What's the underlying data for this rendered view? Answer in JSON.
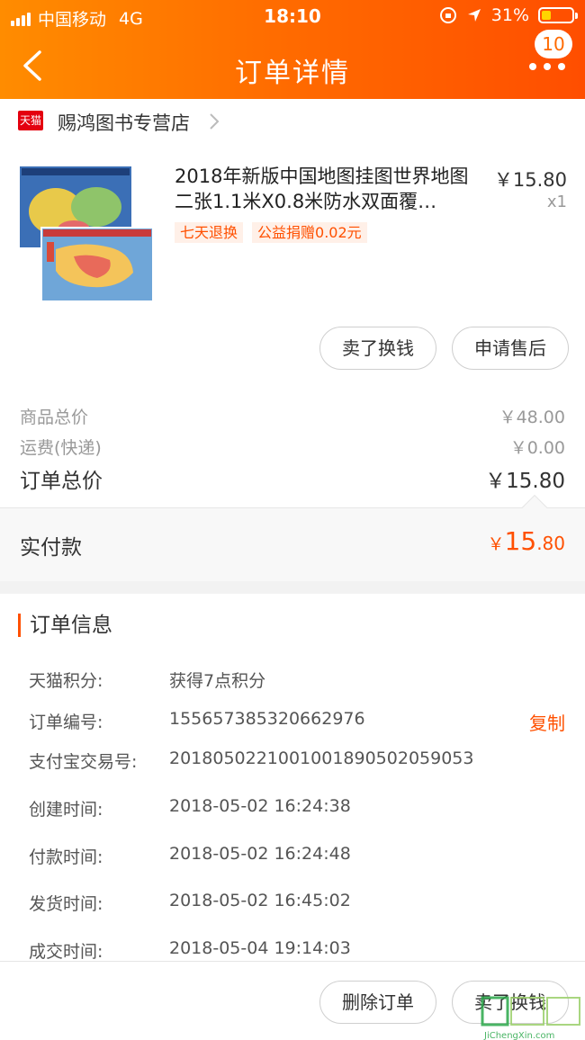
{
  "status_bar": {
    "carrier": "中国移动",
    "network": "4G",
    "time": "18:10",
    "battery": "31%"
  },
  "header": {
    "title": "订单详情",
    "badge": "10"
  },
  "shop": {
    "badge": "天猫",
    "name": "赐鸿图书专营店"
  },
  "product": {
    "title": "2018年新版中国地图挂图世界地图二张1.1米X0.8米防水双面覆…",
    "price": "￥15.80",
    "qty": "x1",
    "tags": [
      "七天退换",
      "公益捐赠0.02元"
    ]
  },
  "actions": {
    "sell": "卖了换钱",
    "after_sale": "申请售后"
  },
  "summary": {
    "goods_label": "商品总价",
    "goods_value": "￥48.00",
    "shipping_label": "运费(快递)",
    "shipping_value": "￥0.00",
    "total_label": "订单总价",
    "total_value": "￥15.80",
    "paid_label": "实付款",
    "paid_currency": "￥",
    "paid_int": "15",
    "paid_dec": ".80"
  },
  "order_info": {
    "heading": "订单信息",
    "copy": "复制",
    "rows": [
      {
        "k": "天猫积分:",
        "v": "获得7点积分"
      },
      {
        "k": "订单编号:",
        "v": "155657385320662976"
      },
      {
        "k": "支付宝交易号:",
        "v": "2018050221001001890502059053"
      },
      {
        "k": "创建时间:",
        "v": "2018-05-02 16:24:38"
      },
      {
        "k": "付款时间:",
        "v": "2018-05-02 16:24:48"
      },
      {
        "k": "发货时间:",
        "v": "2018-05-02 16:45:02"
      },
      {
        "k": "成交时间:",
        "v": "2018-05-04 19:14:03"
      }
    ]
  },
  "bottom": {
    "delete": "删除订单",
    "sell": "卖了换钱"
  },
  "watermark": {
    "text": "JiChengXin.com"
  },
  "colors": {
    "accent": "#ff5000",
    "header_start": "#ff8c00",
    "header_end": "#ff4e00"
  }
}
